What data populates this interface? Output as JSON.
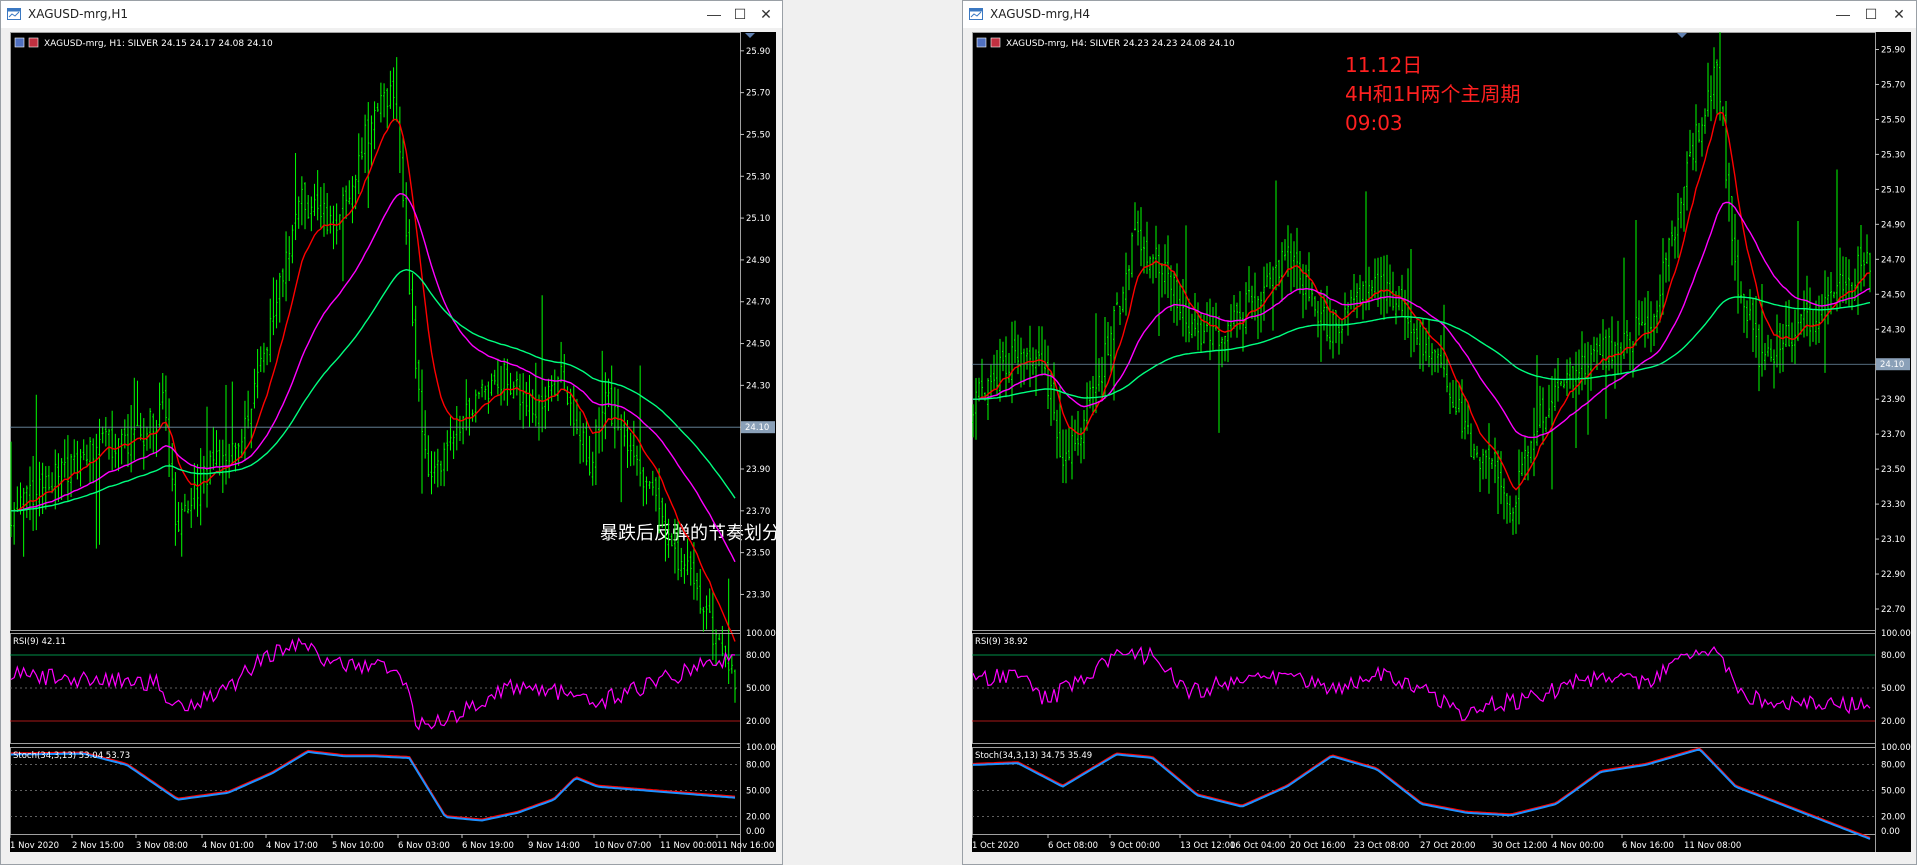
{
  "windows": [
    {
      "title": "XAGUSD-mrg,H1",
      "info": "XAGUSD-mrg, H1:  SILVER  24.15 24.17 24.08 24.10",
      "price_label": "24.10",
      "annotation": "暴跌后反弹的节奏划分",
      "price_ticks": [
        "25.90",
        "25.70",
        "25.50",
        "25.30",
        "25.10",
        "24.90",
        "24.70",
        "24.50",
        "24.30",
        "24.10",
        "23.90",
        "23.70",
        "23.50",
        "23.30"
      ],
      "rsi_label": "RSI(9) 42.11",
      "stoch_label": "Stoch(34,3,13) 53.04 53.73",
      "osc_ticks": [
        "100.00",
        "80.00",
        "50.00",
        "20.00",
        "0.00"
      ],
      "time_ticks": [
        "1 Nov 2020",
        "2 Nov 15:00",
        "3 Nov 08:00",
        "4 Nov 01:00",
        "4 Nov 17:00",
        "5 Nov 10:00",
        "6 Nov 03:00",
        "6 Nov 19:00",
        "9 Nov 14:00",
        "10 Nov 07:00",
        "11 Nov 00:00",
        "11 Nov 16:00"
      ]
    },
    {
      "title": "XAGUSD-mrg,H4",
      "info": "XAGUSD-mrg, H4:  SILVER  24.23 24.23 24.08 24.10",
      "price_label": "24.10",
      "annotation_lines": [
        "11.12日",
        "4H和1H两个主周期",
        "09:03"
      ],
      "price_ticks": [
        "25.90",
        "25.70",
        "25.50",
        "25.30",
        "25.10",
        "24.90",
        "24.70",
        "24.50",
        "24.30",
        "24.10",
        "23.90",
        "23.70",
        "23.50",
        "23.30",
        "23.10",
        "22.90",
        "22.70"
      ],
      "rsi_label": "RSI(9) 38.92",
      "stoch_label": "Stoch(34,3,13) 34.75 35.49",
      "osc_ticks": [
        "100.00",
        "80.00",
        "50.00",
        "20.00",
        "0.00"
      ],
      "time_ticks": [
        "1 Oct 2020",
        "6 Oct 08:00",
        "9 Oct 00:00",
        "13 Oct 12:00",
        "16 Oct 04:00",
        "20 Oct 16:00",
        "23 Oct 08:00",
        "27 Oct 20:00",
        "30 Oct 12:00",
        "4 Nov 00:00",
        "6 Nov 16:00",
        "11 Nov 08:00"
      ]
    }
  ],
  "colors": {
    "candle": "#00ff00",
    "ma_red": "#ff0000",
    "ma_magenta": "#ff00ff",
    "ma_green": "#00ff7f",
    "rsi": "#ff00ff",
    "stoch_main": "#1e90ff",
    "stoch_signal": "#ff0000",
    "annotation_red": "#ff2020"
  }
}
